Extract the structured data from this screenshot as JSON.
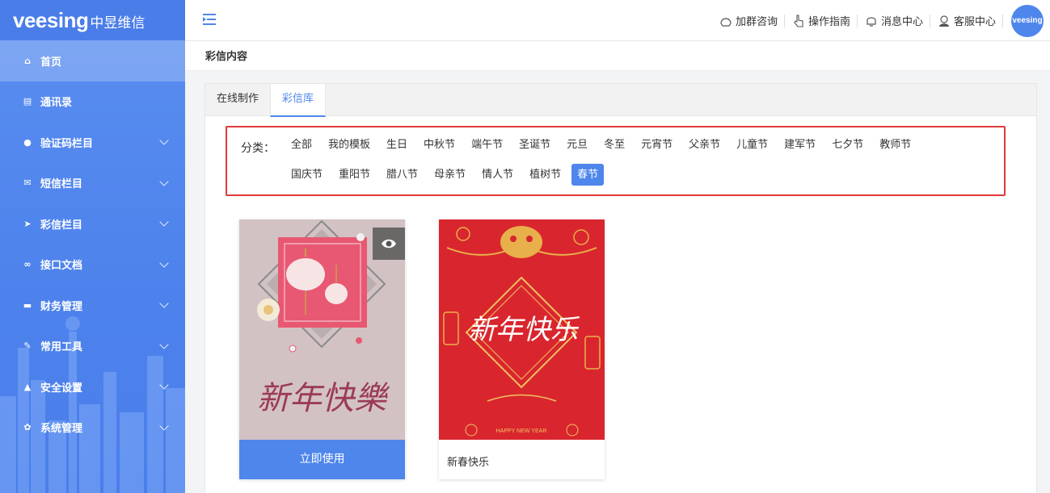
{
  "brand": {
    "name": "veesing",
    "name_cn": "中昱维信"
  },
  "sidebar": {
    "items": [
      {
        "label": "首页",
        "icon": "home-icon",
        "glyph": "⌂",
        "expandable": false,
        "active": true
      },
      {
        "label": "通讯录",
        "icon": "contacts-icon",
        "glyph": "▤",
        "expandable": false,
        "active": false
      },
      {
        "label": "验证码栏目",
        "icon": "chat-icon",
        "glyph": "●",
        "expandable": true,
        "active": false
      },
      {
        "label": "短信栏目",
        "icon": "mail-icon",
        "glyph": "✉",
        "expandable": true,
        "active": false
      },
      {
        "label": "彩信栏目",
        "icon": "send-icon",
        "glyph": "➤",
        "expandable": true,
        "active": false
      },
      {
        "label": "接口文档",
        "icon": "link-icon",
        "glyph": "∞",
        "expandable": true,
        "active": false
      },
      {
        "label": "财务管理",
        "icon": "card-icon",
        "glyph": "▬",
        "expandable": true,
        "active": false
      },
      {
        "label": "常用工具",
        "icon": "wrench-icon",
        "glyph": "✎",
        "expandable": true,
        "active": false
      },
      {
        "label": "安全设置",
        "icon": "warning-icon",
        "glyph": "▲",
        "expandable": true,
        "active": false
      },
      {
        "label": "系统管理",
        "icon": "gear-icon",
        "glyph": "✿",
        "expandable": true,
        "active": false
      }
    ]
  },
  "header": {
    "links": [
      {
        "label": "加群咨询",
        "icon": "group-chat-icon"
      },
      {
        "label": "操作指南",
        "icon": "hand-pointer-icon"
      },
      {
        "label": "消息中心",
        "icon": "bell-icon"
      },
      {
        "label": "客服中心",
        "icon": "support-agent-icon"
      }
    ],
    "avatar_text": "veesing"
  },
  "breadcrumb": {
    "title": "彩信内容"
  },
  "tabs": [
    {
      "label": "在线制作",
      "active": false
    },
    {
      "label": "彩信库",
      "active": true
    }
  ],
  "categories": {
    "label": "分类：",
    "items": [
      "全部",
      "我的模板",
      "生日",
      "中秋节",
      "端午节",
      "圣诞节",
      "元旦",
      "冬至",
      "元宵节",
      "父亲节",
      "儿童节",
      "建军节",
      "七夕节",
      "教师节",
      "国庆节",
      "重阳节",
      "腊八节",
      "母亲节",
      "情人节",
      "植树节",
      "春节"
    ],
    "selected": "春节"
  },
  "cards": [
    {
      "image_text": "新年快樂",
      "action_label": "立即使用",
      "has_preview": true
    },
    {
      "image_text": "新年快乐",
      "banner_text": "HAPPY  NEW  YEAR",
      "title": "新春快乐"
    }
  ],
  "colors": {
    "accent": "#4e86ec",
    "highlight_border": "#e03a3a",
    "card2_bg": "#d9262e",
    "card1_bg": "#d3c2c3"
  }
}
